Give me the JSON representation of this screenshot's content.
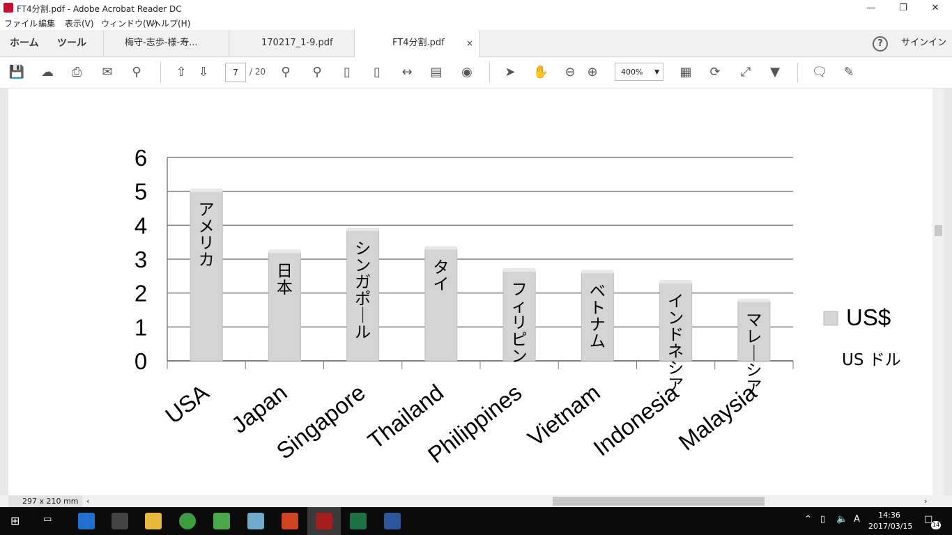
{
  "window": {
    "title": "FT4分割.pdf - Adobe Acrobat Reader DC"
  },
  "menu": [
    "ファイル",
    "編集",
    "表示(V)",
    "ウィンドウ(W)",
    "ヘルプ(H)"
  ],
  "nav": {
    "home": "ホーム",
    "tools": "ツール"
  },
  "tabs": [
    {
      "label": "梅守-志歩-様-寿..."
    },
    {
      "label": "170217_1-9.pdf"
    },
    {
      "label": "FT4分割.pdf",
      "close": "×"
    }
  ],
  "header": {
    "help": "?",
    "signin": "サインイン"
  },
  "toolbar": {
    "page_current": "7",
    "page_total": "/ 20",
    "zoom": "400%"
  },
  "status": {
    "page_size": "297 x 210 mm"
  },
  "taskbar": {
    "time": "14:36",
    "date": "2017/03/15",
    "notifications": "14",
    "ime": "A"
  },
  "chart_data": {
    "type": "bar",
    "categories": [
      "USA",
      "Japan",
      "Singapore",
      "Thailand",
      "Philippines",
      "Vietnam",
      "Indonesia",
      "Malaysia"
    ],
    "bar_labels": [
      "アメリカ",
      "日本",
      "シンガポール",
      "タイ",
      "フィリピン",
      "ベトナム",
      "インドネシア",
      "マレーシア"
    ],
    "series": [
      {
        "name": "US$",
        "values": [
          5.0,
          3.2,
          3.85,
          3.3,
          2.65,
          2.6,
          2.3,
          1.75
        ]
      }
    ],
    "legend_note": "US ドル",
    "yticks": [
      "0",
      "1",
      "2",
      "3",
      "4",
      "5",
      "6"
    ],
    "ylim": [
      0,
      6
    ],
    "grid": true,
    "legend": "right",
    "colors": {
      "bar": "#d4d4d4",
      "bar_edge": "#bdbdbd",
      "grid": "#7f7f7f"
    }
  }
}
